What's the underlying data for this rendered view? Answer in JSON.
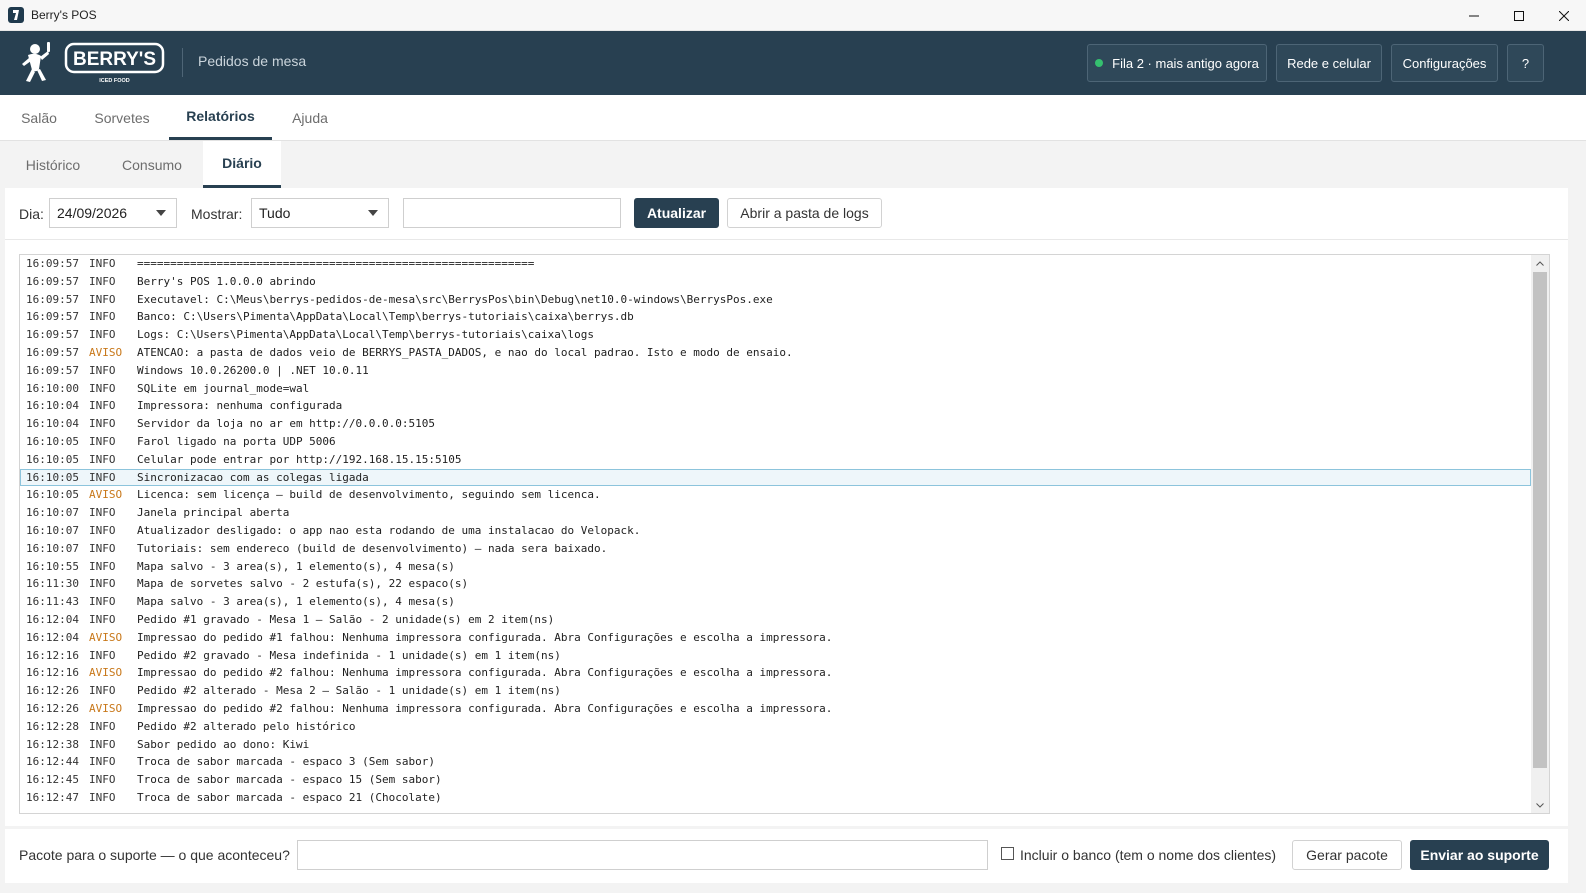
{
  "window": {
    "title": "Berry's POS"
  },
  "header": {
    "logo_text": "BERRY'S",
    "logo_sub": "ICED FOOD",
    "subtitle": "Pedidos de mesa",
    "queue_status": "Fila 2 · mais antigo agora",
    "network_button": "Rede e celular",
    "settings_button": "Configurações",
    "help_button": "?"
  },
  "main_tabs": [
    "Salão",
    "Sorvetes",
    "Relatórios",
    "Ajuda"
  ],
  "sub_tabs": [
    "Histórico",
    "Consumo",
    "Diário"
  ],
  "toolbar": {
    "day_label": "Dia:",
    "day_value": "24/09/2026",
    "show_label": "Mostrar:",
    "show_value": "Tudo",
    "filter_value": "",
    "refresh_button": "Atualizar",
    "open_logs_button": "Abrir a pasta de logs"
  },
  "log": [
    {
      "time": "16:09:57",
      "level": "INFO",
      "msg": "============================================================"
    },
    {
      "time": "16:09:57",
      "level": "INFO",
      "msg": "Berry's POS 1.0.0.0 abrindo"
    },
    {
      "time": "16:09:57",
      "level": "INFO",
      "msg": "Executavel: C:\\Meus\\berrys-pedidos-de-mesa\\src\\BerrysPos\\bin\\Debug\\net10.0-windows\\BerrysPos.exe"
    },
    {
      "time": "16:09:57",
      "level": "INFO",
      "msg": "Banco: C:\\Users\\Pimenta\\AppData\\Local\\Temp\\berrys-tutoriais\\caixa\\berrys.db"
    },
    {
      "time": "16:09:57",
      "level": "INFO",
      "msg": "Logs: C:\\Users\\Pimenta\\AppData\\Local\\Temp\\berrys-tutoriais\\caixa\\logs"
    },
    {
      "time": "16:09:57",
      "level": "AVISO",
      "msg": "ATENCAO: a pasta de dados veio de BERRYS_PASTA_DADOS, e nao do local padrao. Isto e modo de ensaio."
    },
    {
      "time": "16:09:57",
      "level": "INFO",
      "msg": "Windows 10.0.26200.0 | .NET 10.0.11"
    },
    {
      "time": "16:10:00",
      "level": "INFO",
      "msg": "SQLite em journal_mode=wal"
    },
    {
      "time": "16:10:04",
      "level": "INFO",
      "msg": "Impressora: nenhuma configurada"
    },
    {
      "time": "16:10:04",
      "level": "INFO",
      "msg": "Servidor da loja no ar em http://0.0.0.0:5105"
    },
    {
      "time": "16:10:05",
      "level": "INFO",
      "msg": "Farol ligado na porta UDP 5006"
    },
    {
      "time": "16:10:05",
      "level": "INFO",
      "msg": "Celular pode entrar por http://192.168.15.15:5105"
    },
    {
      "time": "16:10:05",
      "level": "INFO",
      "msg": "Sincronizacao com as colegas ligada"
    },
    {
      "time": "16:10:05",
      "level": "AVISO",
      "msg": "Licenca: sem licença — build de desenvolvimento, seguindo sem licenca."
    },
    {
      "time": "16:10:07",
      "level": "INFO",
      "msg": "Janela principal aberta"
    },
    {
      "time": "16:10:07",
      "level": "INFO",
      "msg": "Atualizador desligado: o app nao esta rodando de uma instalacao do Velopack."
    },
    {
      "time": "16:10:07",
      "level": "INFO",
      "msg": "Tutoriais: sem endereco (build de desenvolvimento) — nada sera baixado."
    },
    {
      "time": "16:10:55",
      "level": "INFO",
      "msg": "Mapa salvo - 3 area(s), 1 elemento(s), 4 mesa(s)"
    },
    {
      "time": "16:11:30",
      "level": "INFO",
      "msg": "Mapa de sorvetes salvo - 2 estufa(s), 22 espaco(s)"
    },
    {
      "time": "16:11:43",
      "level": "INFO",
      "msg": "Mapa salvo - 3 area(s), 1 elemento(s), 4 mesa(s)"
    },
    {
      "time": "16:12:04",
      "level": "INFO",
      "msg": "Pedido #1 gravado - Mesa 1 — Salão - 2 unidade(s) em 2 item(ns)"
    },
    {
      "time": "16:12:04",
      "level": "AVISO",
      "msg": "Impressao do pedido #1 falhou: Nenhuma impressora configurada. Abra Configurações e escolha a impressora."
    },
    {
      "time": "16:12:16",
      "level": "INFO",
      "msg": "Pedido #2 gravado - Mesa indefinida - 1 unidade(s) em 1 item(ns)"
    },
    {
      "time": "16:12:16",
      "level": "AVISO",
      "msg": "Impressao do pedido #2 falhou: Nenhuma impressora configurada. Abra Configurações e escolha a impressora."
    },
    {
      "time": "16:12:26",
      "level": "INFO",
      "msg": "Pedido #2 alterado - Mesa 2 — Salão - 1 unidade(s) em 1 item(ns)"
    },
    {
      "time": "16:12:26",
      "level": "AVISO",
      "msg": "Impressao do pedido #2 falhou: Nenhuma impressora configurada. Abra Configurações e escolha a impressora."
    },
    {
      "time": "16:12:28",
      "level": "INFO",
      "msg": "Pedido #2 alterado pelo histórico"
    },
    {
      "time": "16:12:38",
      "level": "INFO",
      "msg": "Sabor pedido ao dono: Kiwi"
    },
    {
      "time": "16:12:44",
      "level": "INFO",
      "msg": "Troca de sabor marcada - espaco 3 (Sem sabor)"
    },
    {
      "time": "16:12:45",
      "level": "INFO",
      "msg": "Troca de sabor marcada - espaco 15 (Sem sabor)"
    },
    {
      "time": "16:12:47",
      "level": "INFO",
      "msg": "Troca de sabor marcada - espaco 21 (Chocolate)"
    }
  ],
  "selected_log_index": 12,
  "bottom": {
    "support_label": "Pacote para o suporte — o que aconteceu?",
    "support_value": "",
    "include_db_label": "Incluir o banco (tem o nome dos clientes)",
    "include_db_checked": false,
    "generate_button": "Gerar pacote",
    "send_button": "Enviar ao suporte"
  },
  "colors": {
    "header": "#284051",
    "accent": "#284051",
    "warn": "#c8781a",
    "status_ok": "#35c06f"
  }
}
